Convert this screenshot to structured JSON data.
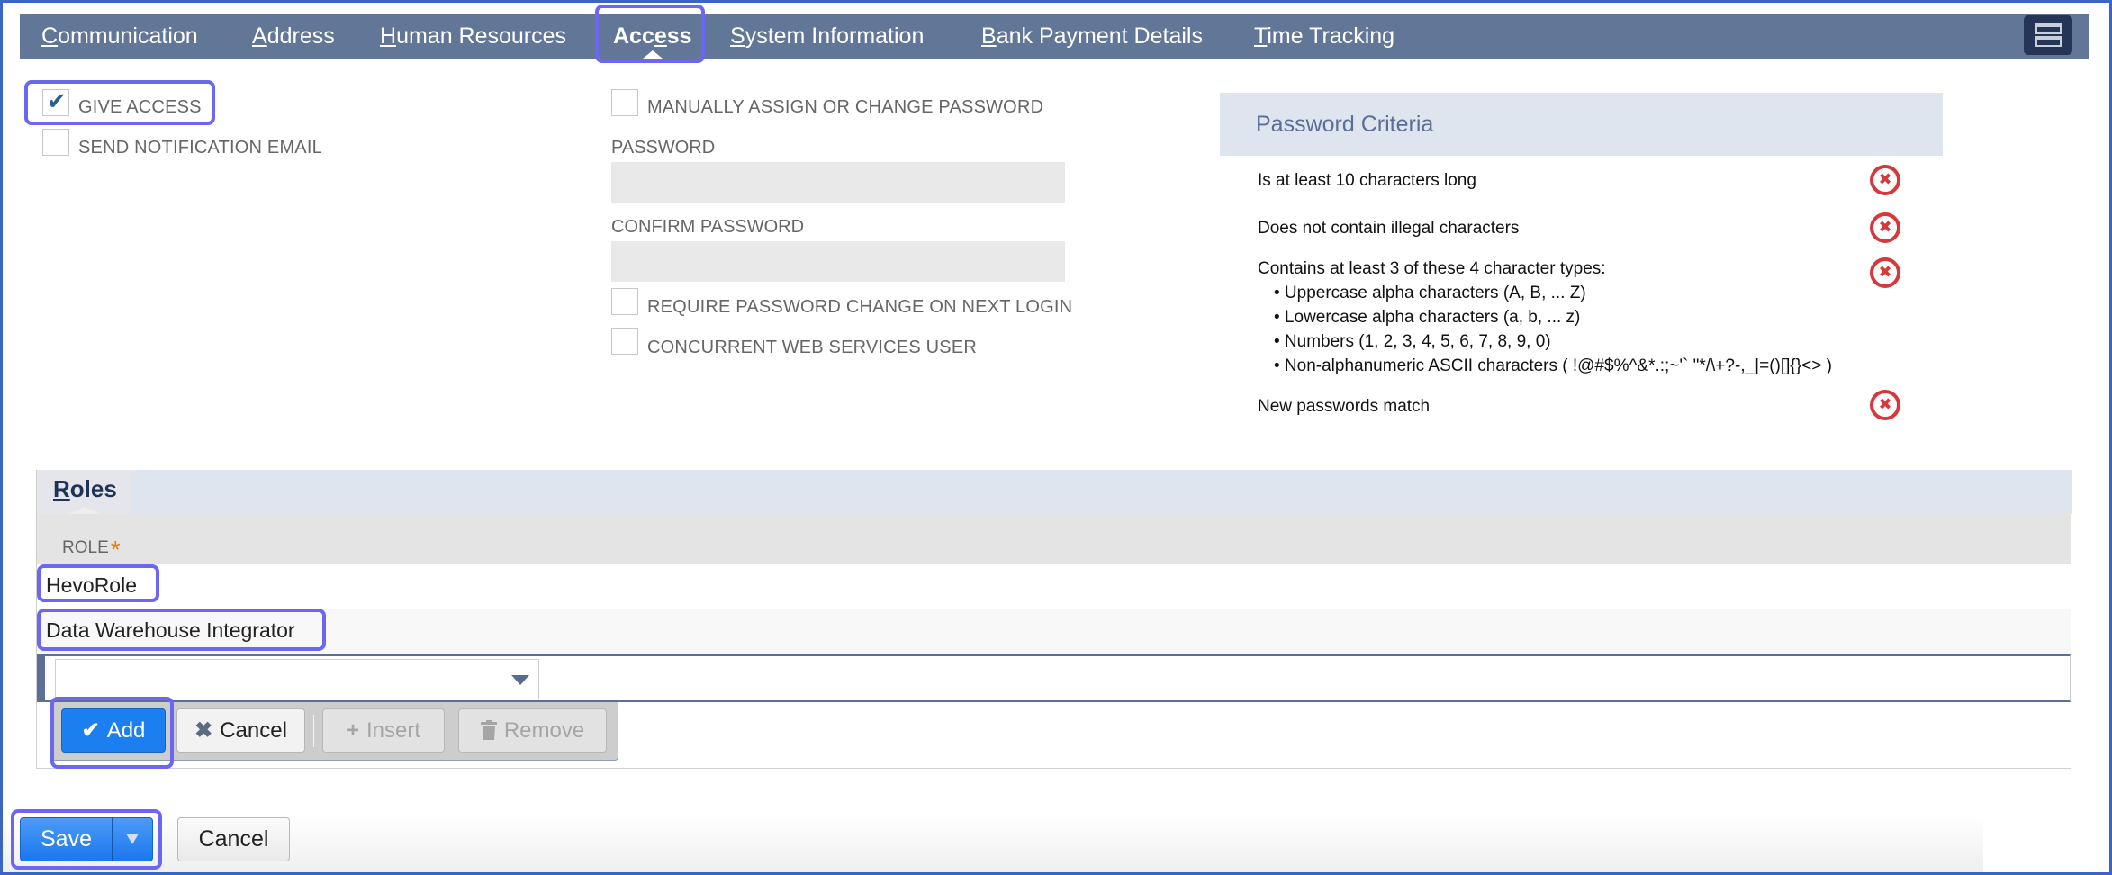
{
  "tabs": [
    {
      "label": "Communication",
      "underline": "C",
      "rest": "ommunication",
      "active": false
    },
    {
      "label": "Address",
      "underline": "A",
      "rest": "ddress",
      "active": false
    },
    {
      "label": "Human Resources",
      "underline": "H",
      "rest": "uman Resources",
      "active": false
    },
    {
      "label": "Access",
      "pre": "Acc",
      "underline": "e",
      "rest": "ss",
      "active": true
    },
    {
      "label": "System Information",
      "underline": "S",
      "rest": "ystem Information",
      "active": false
    },
    {
      "label": "Bank Payment Details",
      "underline": "B",
      "rest": "ank Payment Details",
      "active": false
    },
    {
      "label": "Time Tracking",
      "underline": "T",
      "rest": "ime Tracking",
      "active": false
    }
  ],
  "access": {
    "give_access": {
      "label": "GIVE ACCESS",
      "checked": true
    },
    "send_notification": {
      "label": "SEND NOTIFICATION EMAIL",
      "checked": false
    },
    "manually_assign": {
      "label": "MANUALLY ASSIGN OR CHANGE PASSWORD",
      "checked": false
    },
    "password_label": "PASSWORD",
    "password_value": "",
    "confirm_password_label": "CONFIRM PASSWORD",
    "confirm_password_value": "",
    "require_change": {
      "label": "REQUIRE PASSWORD CHANGE ON NEXT LOGIN",
      "checked": false
    },
    "concurrent_ws": {
      "label": "CONCURRENT WEB SERVICES USER",
      "checked": false
    }
  },
  "criteria": {
    "title": "Password Criteria",
    "items": [
      {
        "text": "Is at least 10 characters long",
        "status": "fail"
      },
      {
        "text": "Does not contain illegal characters",
        "status": "fail"
      },
      {
        "text": "Contains at least 3 of these 4 character types:",
        "status": "fail"
      },
      {
        "text": "New passwords match",
        "status": "fail"
      }
    ],
    "subitems": [
      "• Uppercase alpha characters (A, B, ... Z)",
      "• Lowercase alpha characters (a, b, ... z)",
      "• Numbers (1, 2, 3, 4, 5, 6, 7, 8, 9, 0)",
      "• Non-alphanumeric ASCII characters ( !@#$%^&*.:;~'` \"*/\\+?-,_|=()[]{}<> )"
    ],
    "fail_icon": "✖",
    "fail_color": "#d6383b"
  },
  "roles": {
    "title_underline": "R",
    "title_rest": "oles",
    "column": "ROLE",
    "required_mark": "*",
    "rows": [
      "HevoRole",
      "Data Warehouse Integrator"
    ],
    "select_value": "",
    "buttons": {
      "add": {
        "icon": "✔",
        "label": "Add"
      },
      "cancel": {
        "icon": "✖",
        "label": "Cancel"
      },
      "insert": {
        "icon": "+",
        "label": "Insert"
      },
      "remove": {
        "icon": "trash",
        "label": "Remove"
      }
    }
  },
  "footer": {
    "save_label": "Save",
    "cancel_label": "Cancel"
  },
  "colors": {
    "tabbar": "#627798",
    "primary": "#1b7ff0",
    "highlight": "#6b67f2"
  }
}
